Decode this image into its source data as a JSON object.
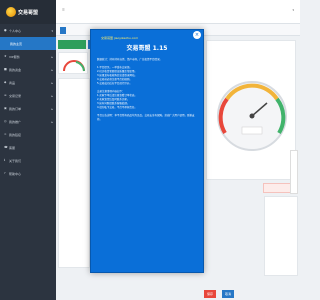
{
  "sidebar": {
    "brand": "交易哥盟",
    "items": [
      {
        "label": "个人中心"
      },
      {
        "label": "我的主页"
      },
      {
        "label": "VIP服务"
      },
      {
        "label": "我的资金"
      },
      {
        "label": "商品"
      },
      {
        "label": "交易记录"
      },
      {
        "label": "我的订单"
      },
      {
        "label": "我的推广"
      },
      {
        "label": "我的链接"
      },
      {
        "label": "客服"
      },
      {
        "label": "关于我们"
      },
      {
        "label": "帮助中心"
      }
    ]
  },
  "modal": {
    "site": "交易哥盟 jiaoyikezhu.com",
    "title": "交易哥盟 1.15",
    "close_icon": "close-icon",
    "body": "数据统计：持有持有自然、资产市场、广告投资平台情况。\n\n1.平台提示，一单发布交易须。\n2.已买收货者要保证质量正常使用。\n3.如果发布和收购信息请登录网站。\n4.交易前必须注意平台的规则。\n5.交易成功后在平台进行评价。\n\n交易注意事项内容如下：\n1.买家下单后请注意查看订单状态。\n2.卖家发货后及时联系买家。\n3.如有问题请联系客服处理。\n4.请勿私下交易，平台不承担责任。\n\n平台公告说明：本平台所有商品均为正品，交易安全有保障，欢迎广大用户使用，感谢支持。"
  },
  "bottom_buttons": [
    {
      "label": "保存"
    },
    {
      "label": "取消"
    }
  ],
  "colors": {
    "sidebar": "#2c3440",
    "accent": "#2577c6",
    "modal": "#0a6fd8",
    "gauge_red": "#e8473b",
    "gauge_green": "#41b36b"
  }
}
